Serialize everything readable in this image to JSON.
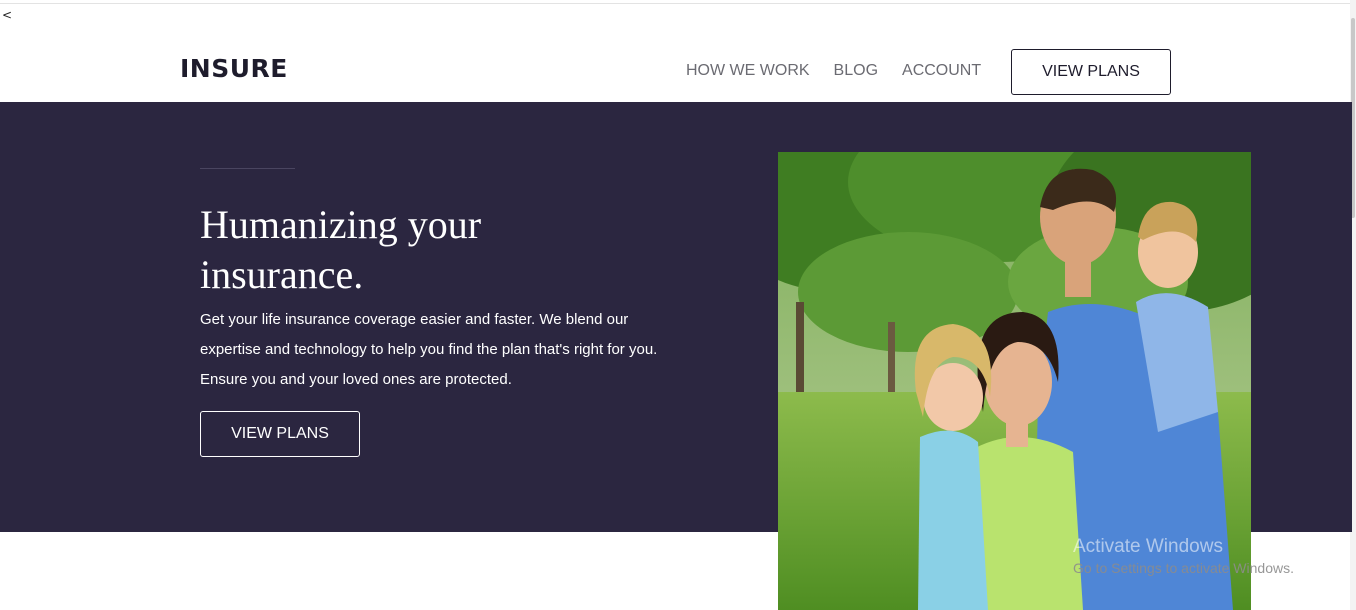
{
  "page": {
    "stray_char": "<"
  },
  "header": {
    "logo": "INSURE",
    "nav": [
      "HOW WE WORK",
      "BLOG",
      "ACCOUNT"
    ],
    "cta_label": "VIEW PLANS"
  },
  "hero": {
    "title": "Humanizing your insurance.",
    "text": "Get your life insurance coverage easier and faster. We blend our expertise and technology to help you find the plan that's right for you. Ensure you and your loved ones are protected.",
    "cta_label": "VIEW PLANS",
    "image": "family-photo"
  },
  "watermark": {
    "title": "Activate Windows",
    "subtitle": "Go to Settings to activate Windows."
  },
  "colors": {
    "hero_bg": "#2b2640",
    "brand_dark": "#1e1c2c",
    "nav_text": "#6b6b72"
  }
}
